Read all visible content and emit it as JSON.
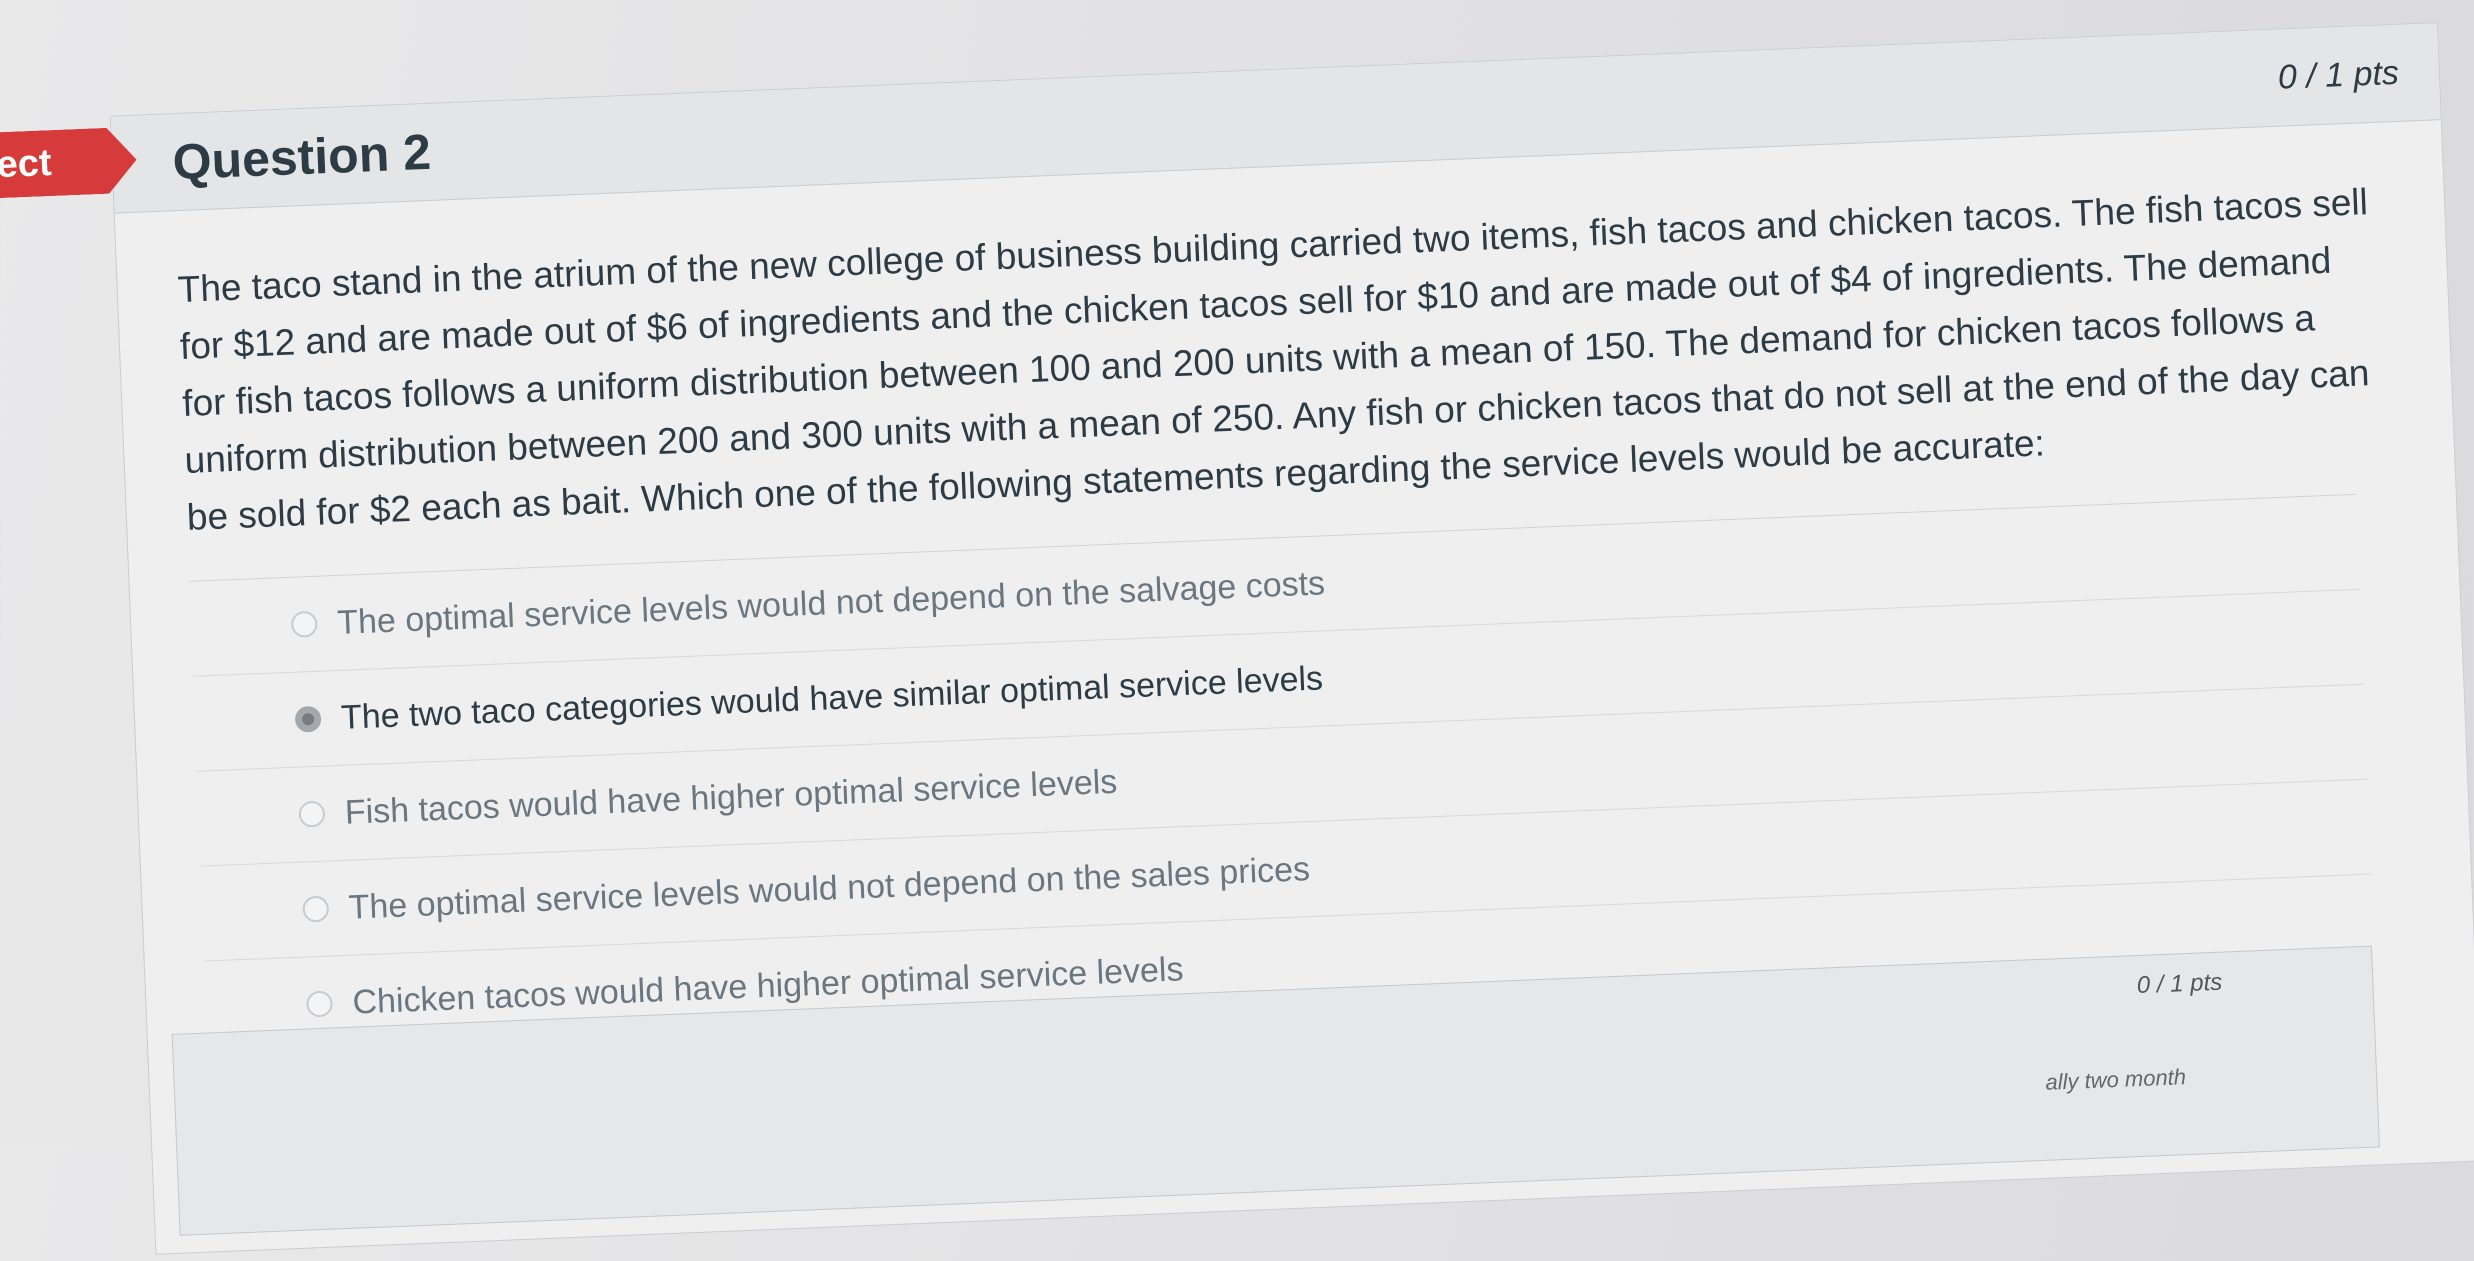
{
  "status_flag": "ect",
  "question": {
    "title": "Question 2",
    "points": "0 / 1 pts",
    "text": "The taco stand in the atrium of the new college of business building carried two items, fish tacos and chicken tacos. The fish tacos sell for $12 and are made out of $6 of ingredients and the chicken tacos sell for $10 and are made out of $4 of ingredients. The demand for fish tacos follows a uniform distribution between 100 and 200 units with a mean of 150. The demand for chicken tacos follows a uniform distribution between 200 and 300 units with a mean of 250. Any fish or chicken tacos that do not sell at the end of the day can be sold for $2 each as bait. Which one of the following statements regarding the service levels would be accurate:",
    "answers": [
      {
        "label": "The optimal service levels would not depend on the salvage costs",
        "selected": false
      },
      {
        "label": "The two taco categories would have similar optimal service levels",
        "selected": true
      },
      {
        "label": "Fish tacos would have higher optimal service levels",
        "selected": false
      },
      {
        "label": "The optimal service levels would not depend on the sales prices",
        "selected": false
      },
      {
        "label": "Chicken tacos would have higher optimal service levels",
        "selected": false
      }
    ]
  },
  "next_question": {
    "points": "0 / 1 pts",
    "text_fragment": "ally two month"
  }
}
